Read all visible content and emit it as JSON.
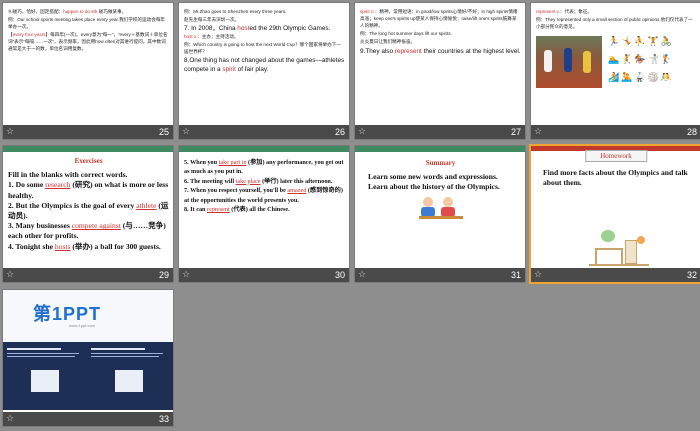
{
  "slides": [
    {
      "number": "25",
      "lines": [
        {
          "pre": "⑥碰巧，恰好，固定搭配：",
          "hl": "happen to do sth.",
          "post": "碰巧做某事。"
        },
        {
          "pre": "例：Our school sports meeting takes place every year.我们学校的运动会每年举办一次。",
          "hl": "",
          "post": ""
        },
        {
          "pre": "【",
          "hl": "every four years",
          "post": "】每四年(一次)。every意为“每一”，“every＋基数词＋单位名词”表示“每隔……一次”，表示频率，因此用how often对其进行提问。其中数词通常是大于一的数，单位名词用复数。"
        }
      ]
    },
    {
      "number": "26",
      "lines": [
        {
          "pre": "例：Mr.Zhao goes to Shenzhen every three years.",
          "hl": "",
          "post": ""
        },
        {
          "pre": "赵先生每三年去深圳一次。",
          "hl": "",
          "post": ""
        },
        {
          "pre": "7. In 2008，China ",
          "hl": "host",
          "post": "ed the 29th Olympic Games."
        },
        {
          "pre": "",
          "hl": "host v.",
          "post": "：主办；主持活动。"
        },
        {
          "pre": "例：Which country is going to host the next World Cup？哪个国家将举办下一届世界杯？",
          "hl": "",
          "post": ""
        },
        {
          "pre": "8.One thing has not changed about the games—athletes compete in a ",
          "hl": "spirit",
          "post": " of fair play."
        }
      ]
    },
    {
      "number": "27",
      "lines": [
        {
          "pre": "",
          "hl": "spirit n.",
          "post": "：精神。常用短语：in good/low spirits心情好/不好；in high spirits情绪高涨；keep one's spirits up使某人保持心情愉悦；raise/lift one's spirits鼓舞某人的精神。"
        },
        {
          "pre": "例：The long hot summer days lift our spirits.",
          "hl": "",
          "post": ""
        },
        {
          "pre": "炎炎夏日让我们精神振奋。",
          "hl": "",
          "post": ""
        },
        {
          "pre": "9.They also ",
          "hl": "represent",
          "post": " their countries at the highest level."
        }
      ]
    },
    {
      "number": "28",
      "lines": [
        {
          "pre": "",
          "hl": "represent v.",
          "post": "：代表；象征。"
        },
        {
          "pre": "例：They represented only a small section of public opinions.他们仅代表了一小部分民众的意见。",
          "hl": "",
          "post": ""
        }
      ]
    },
    {
      "number": "29",
      "title": "Exercises",
      "lines": [
        {
          "pre": "Fill in the blanks with correct words.",
          "hl": "",
          "post": ""
        },
        {
          "pre": "1. Do some ",
          "hl": "research",
          "post": " (研究) on what is more or less healthy."
        },
        {
          "pre": "2. But the Olympics is the goal of every ",
          "hl": "athlete",
          "post": " (运动员)."
        },
        {
          "pre": "3. Many businesses ",
          "hl": "compete against",
          "post": " (与……竞争) each other for profits."
        },
        {
          "pre": "4. Tonight she ",
          "hl": "hosts",
          "post": " (举办) a ball for 300 guests."
        }
      ]
    },
    {
      "number": "30",
      "lines": [
        {
          "pre": "5. When you ",
          "hl": "take part in",
          "post": " (参加) any performance, you get out as much as you put in."
        },
        {
          "pre": "6. The meeting will ",
          "hl": "take place",
          "post": " (举行) later this afternoon."
        },
        {
          "pre": "7. When you respect yourself, you'll be ",
          "hl": "amazed",
          "post": " (感到惊奇的) at the opportunities the world presents you."
        },
        {
          "pre": "8. It can ",
          "hl": "represent",
          "post": " (代表) all the Chinese."
        }
      ]
    },
    {
      "number": "31",
      "title": "Summary",
      "lines": [
        {
          "pre": "Learn some new words and expressions.",
          "hl": "",
          "post": ""
        },
        {
          "pre": "Learn about the history of the Olympics.",
          "hl": "",
          "post": ""
        }
      ]
    },
    {
      "number": "32",
      "title": "Homework",
      "lines": [
        {
          "pre": "Find more facts about the Olympics and talk about them.",
          "hl": "",
          "post": ""
        }
      ]
    },
    {
      "number": "33",
      "logo": "第1PPT",
      "logo_sub": "www.1ppt.com"
    }
  ]
}
